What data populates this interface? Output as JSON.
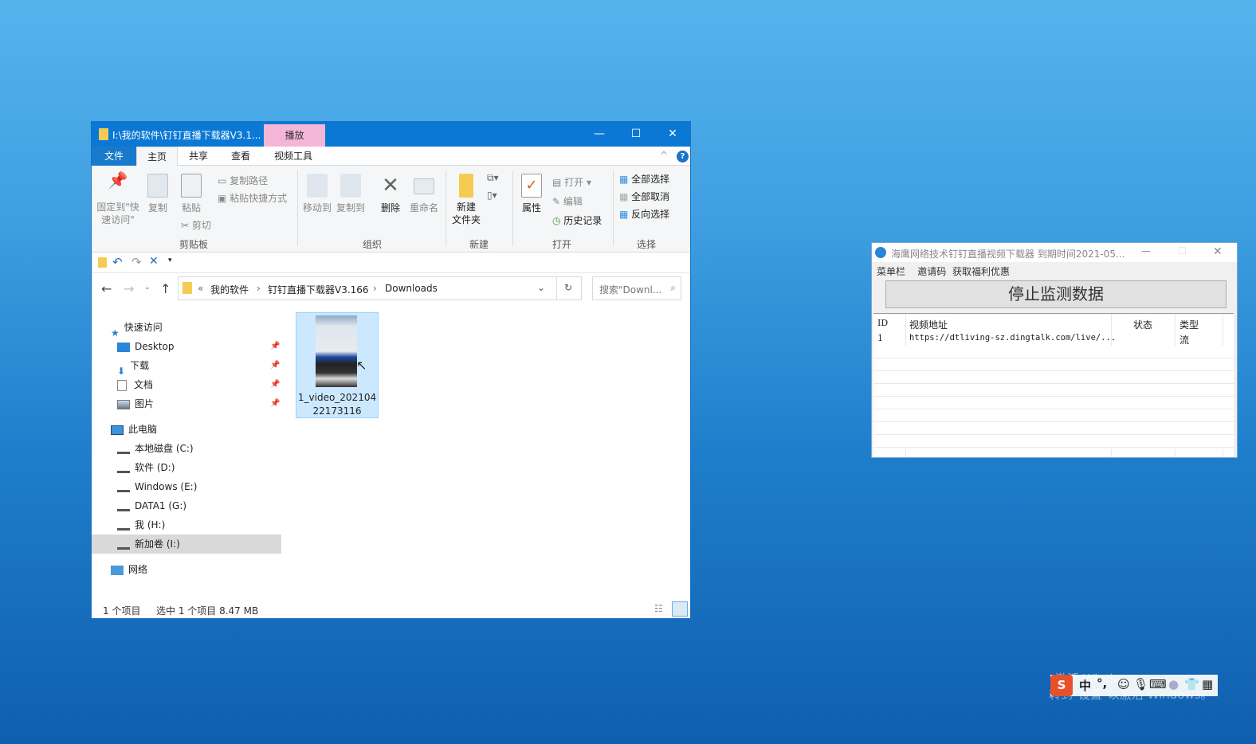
{
  "explorer": {
    "title": "I:\\我的软件\\钉钉直播下载器V3.1...",
    "context_tab": "播放",
    "tabs": [
      "文件",
      "主页",
      "共享",
      "查看",
      "视频工具"
    ],
    "ribbon": {
      "pin": "固定到\"快\n速访问\"",
      "copy": "复制",
      "paste": "粘贴",
      "copy_path": "复制路径",
      "paste_shortcut": "粘贴快捷方式",
      "cut": "剪切",
      "clipboard": "剪贴板",
      "move_to": "移动到",
      "copy_to": "复制到",
      "delete": "删除",
      "rename": "重命名",
      "organize": "组织",
      "new_folder": "新建\n文件夹",
      "new": "新建",
      "properties": "属性",
      "open": "打开",
      "edit": "编辑",
      "history": "历史记录",
      "open_group": "打开",
      "select_all": "全部选择",
      "select_none": "全部取消",
      "invert": "反向选择",
      "select": "选择"
    },
    "breadcrumb": [
      "«",
      "我的软件",
      "钉钉直播下载器V3.166",
      "Downloads"
    ],
    "search_placeholder": "搜索\"Downl...",
    "nav": {
      "quick_access": "快速访问",
      "pinned": [
        "Desktop",
        "下载",
        "文档",
        "图片"
      ],
      "this_pc": "此电脑",
      "drives": [
        "本地磁盘 (C:)",
        "软件 (D:)",
        "Windows (E:)",
        "DATA1 (G:)",
        "我 (H:)",
        "新加卷 (I:)"
      ],
      "network": "网络"
    },
    "file": {
      "name": "1_video_202104\n22173116"
    },
    "status": {
      "count": "1 个项目",
      "selected": "选中 1 个项目  8.47 MB"
    }
  },
  "app": {
    "title": "海鹰网络技术钉钉直播视频下载器   到期时间2021-05...",
    "menu": [
      "菜单栏",
      "邀请码",
      "获取福利优惠"
    ],
    "button": "停止监测数据",
    "columns": [
      "ID",
      "视频地址",
      "状态",
      "类型"
    ],
    "rows": [
      {
        "id": "1",
        "url": "https://dtliving-sz.dingtalk.com/live/...",
        "status": "",
        "type": "流"
      }
    ]
  },
  "watermark": {
    "line1": "激活 Windows",
    "line2": "转到\"设置\"以激活 Windows。"
  },
  "ime": {
    "lang": "中",
    "punct": "°,"
  }
}
